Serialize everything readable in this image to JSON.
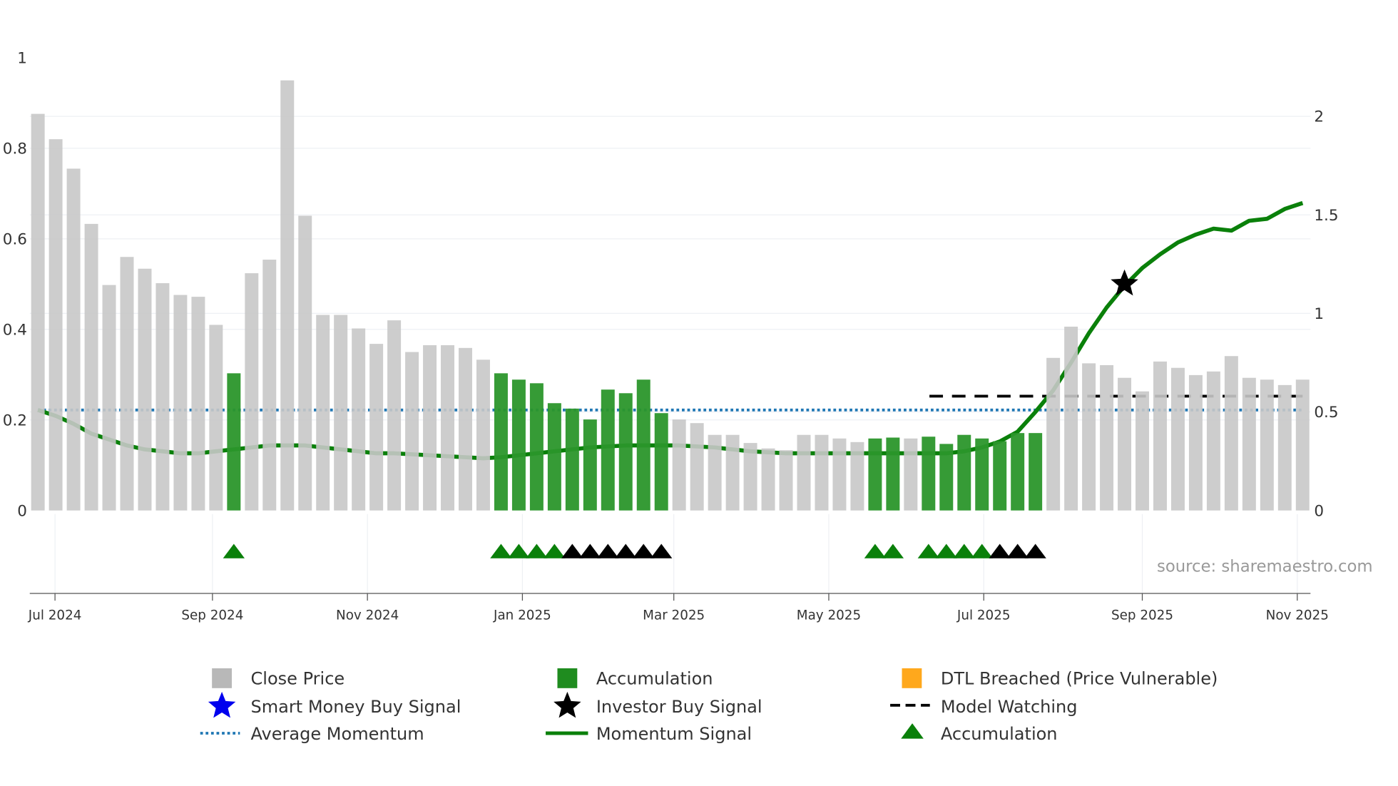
{
  "chart_data": {
    "type": "bar",
    "title": "",
    "left_axis": {
      "ticks": [
        "0",
        "0.2",
        "0.4",
        "0.6",
        "0.8",
        "1"
      ],
      "tick_values": [
        0,
        0.2,
        0.4,
        0.6,
        0.8,
        1
      ],
      "ylim": [
        0,
        1
      ]
    },
    "right_axis": {
      "ticks": [
        "0",
        "0.5",
        "1",
        "1.5",
        "2"
      ],
      "tick_values": [
        0,
        0.5,
        1,
        1.5,
        2
      ],
      "ylim": [
        0,
        2.3
      ]
    },
    "x_ticks": [
      {
        "label": "Jul 2024",
        "x": 1.96
      },
      {
        "label": "Sep 2024",
        "x": 10.8
      },
      {
        "label": "Nov 2024",
        "x": 19.5
      },
      {
        "label": "Jan 2025",
        "x": 28.2
      },
      {
        "label": "Mar 2025",
        "x": 36.7
      },
      {
        "label": "May 2025",
        "x": 45.4
      },
      {
        "label": "Jul 2025",
        "x": 54.1
      },
      {
        "label": "Sep 2025",
        "x": 63.0
      },
      {
        "label": "Nov 2025",
        "x": 71.7
      }
    ],
    "close_price": [
      0.876,
      0.82,
      0.755,
      0.633,
      0.498,
      0.56,
      0.534,
      0.502,
      0.476,
      0.472,
      0.41,
      0.303,
      0.524,
      0.554,
      0.95,
      0.651,
      0.432,
      0.432,
      0.402,
      0.368,
      0.42,
      0.35,
      0.365,
      0.365,
      0.359,
      0.333,
      0.303,
      0.289,
      0.281,
      0.237,
      0.225,
      0.201,
      0.267,
      0.259,
      0.289,
      0.215,
      0.201,
      0.193,
      0.167,
      0.167,
      0.149,
      0.137,
      0.133,
      0.167,
      0.167,
      0.159,
      0.151,
      0.159,
      0.161,
      0.159,
      0.163,
      0.147,
      0.167,
      0.159,
      0.153,
      0.171,
      0.171,
      0.337,
      0.406,
      0.325,
      0.321,
      0.293,
      0.263,
      0.329,
      0.315,
      0.299,
      0.307,
      0.341,
      0.293,
      0.289,
      0.277,
      0.289
    ],
    "accumulation_bars": [
      12,
      27,
      28,
      29,
      30,
      31,
      32,
      33,
      34,
      35,
      36,
      48,
      49,
      51,
      52,
      53,
      54,
      55,
      56,
      57
    ],
    "momentum_signal": [
      0.51,
      0.48,
      0.44,
      0.39,
      0.36,
      0.33,
      0.31,
      0.3,
      0.29,
      0.29,
      0.3,
      0.31,
      0.32,
      0.33,
      0.33,
      0.33,
      0.32,
      0.31,
      0.3,
      0.29,
      0.29,
      0.285,
      0.28,
      0.275,
      0.27,
      0.265,
      0.27,
      0.28,
      0.29,
      0.3,
      0.31,
      0.32,
      0.325,
      0.33,
      0.33,
      0.33,
      0.33,
      0.325,
      0.32,
      0.31,
      0.3,
      0.295,
      0.29,
      0.29,
      0.29,
      0.29,
      0.29,
      0.29,
      0.29,
      0.29,
      0.29,
      0.29,
      0.3,
      0.32,
      0.35,
      0.4,
      0.5,
      0.61,
      0.75,
      0.9,
      1.03,
      1.14,
      1.23,
      1.3,
      1.36,
      1.4,
      1.43,
      1.42,
      1.47,
      1.48,
      1.53,
      1.56
    ],
    "average_momentum": 0.51,
    "model_watching": {
      "value": 0.58,
      "from_bar": 51,
      "to_bar": 72
    },
    "investor_buy_signals": [
      {
        "bar": 62,
        "value": 1.15
      }
    ],
    "accumulation_markers": {
      "green": [
        12,
        27,
        28,
        29,
        30,
        48,
        49,
        51,
        52,
        53,
        54
      ],
      "black": [
        31,
        32,
        33,
        34,
        35,
        36,
        55,
        56,
        57
      ]
    },
    "colors": {
      "close": "#c8c8c8",
      "accum": "#2b962b",
      "momentum": "#0a800a",
      "avg": "#1f77b4",
      "watch": "#000000",
      "dtl": "#ffa500",
      "smart": "#0000ee"
    },
    "annotation": "source: sharemaestro.com",
    "legend": [
      {
        "label": "Close Price",
        "icon": "gray-square"
      },
      {
        "label": "Accumulation",
        "icon": "green-square"
      },
      {
        "label": "DTL Breached (Price Vulnerable)",
        "icon": "orange-square"
      },
      {
        "label": "Smart Money Buy Signal",
        "icon": "blue-star"
      },
      {
        "label": "Investor Buy Signal",
        "icon": "black-star"
      },
      {
        "label": "Model Watching",
        "icon": "black-dash-line"
      },
      {
        "label": "Average Momentum",
        "icon": "blue-dotted-line"
      },
      {
        "label": "Momentum Signal",
        "icon": "green-line"
      },
      {
        "label": "Accumulation",
        "icon": "green-triangle"
      }
    ]
  }
}
